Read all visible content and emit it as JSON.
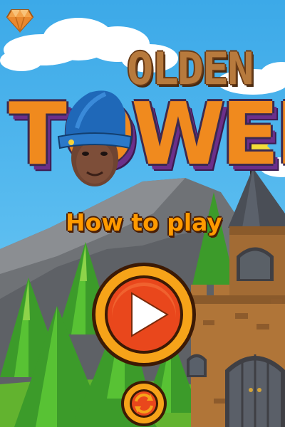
{
  "title": {
    "line1": "OLDEN",
    "line2": "TOWER"
  },
  "menu": {
    "how_to_play": "How to play"
  },
  "icons": {
    "gem": "diamond-icon",
    "play": "play-icon",
    "restart": "refresh-icon"
  },
  "colors": {
    "sky": "#4db4ec",
    "play_outer": "#f6a319",
    "play_inner": "#e9471c",
    "title_orange": "#f08a1e"
  }
}
